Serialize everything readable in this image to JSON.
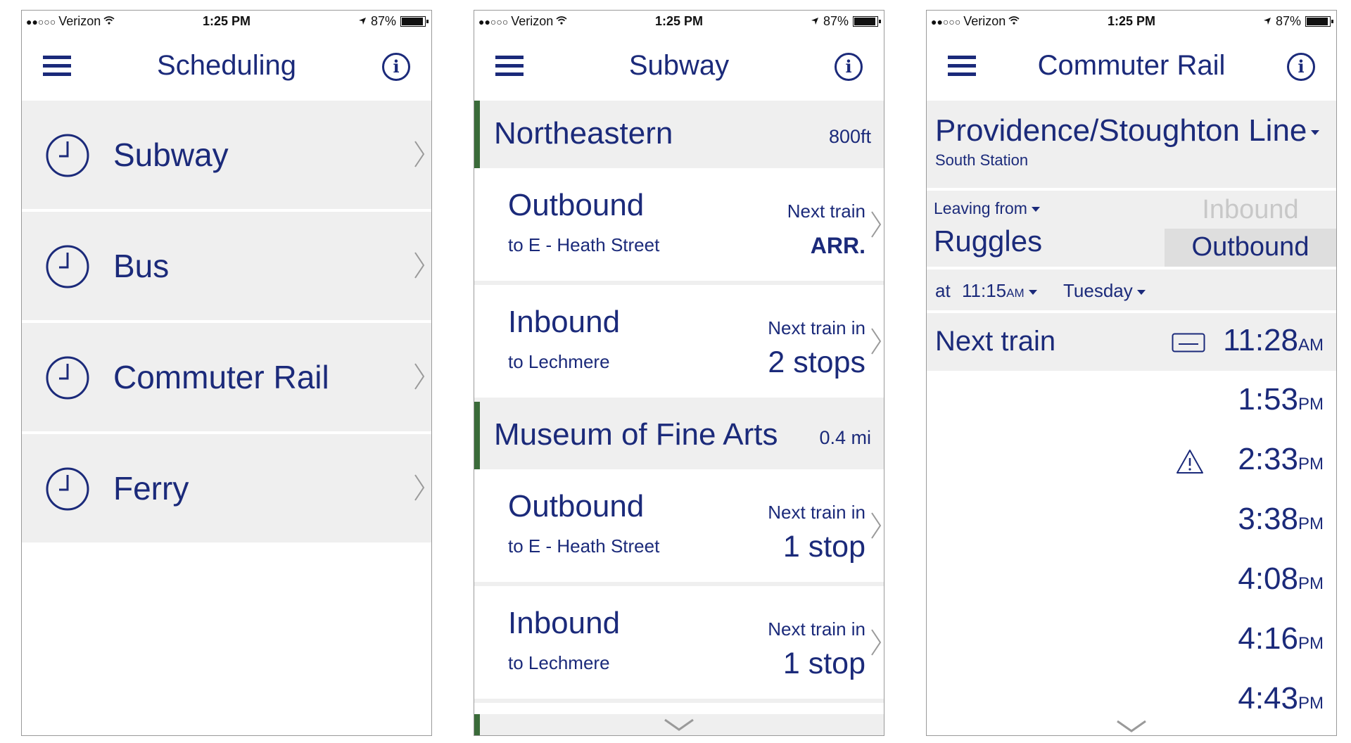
{
  "status_bar": {
    "signal_dots": "●●○○○",
    "carrier": "Verizon",
    "time": "1:25 PM",
    "battery": "87%",
    "battery_level": 0.87
  },
  "panel1": {
    "title": "Scheduling",
    "items": [
      {
        "label": "Subway"
      },
      {
        "label": "Bus"
      },
      {
        "label": "Commuter Rail"
      },
      {
        "label": "Ferry"
      }
    ]
  },
  "panel2": {
    "title": "Subway",
    "stations": [
      {
        "name": "Northeastern",
        "distance": "800ft",
        "directions": [
          {
            "direction": "Outbound",
            "destination": "to E - Heath Street",
            "next_label": "Next train",
            "next_value": "ARR."
          },
          {
            "direction": "Inbound",
            "destination": "to Lechmere",
            "next_label": "Next train in",
            "next_value": "2 stops"
          }
        ]
      },
      {
        "name": "Museum of Fine Arts",
        "distance": "0.4 mi",
        "directions": [
          {
            "direction": "Outbound",
            "destination": "to E - Heath Street",
            "next_label": "Next train in",
            "next_value": "1 stop"
          },
          {
            "direction": "Inbound",
            "destination": "to Lechmere",
            "next_label": "Next train in",
            "next_value": "1 stop"
          }
        ]
      }
    ]
  },
  "panel3": {
    "title": "Commuter Rail",
    "line_name": "Providence/Stoughton Line",
    "line_origin": "South Station",
    "leaving_label": "Leaving from",
    "leaving_station": "Ruggles",
    "direction_inactive": "Inbound",
    "direction_active": "Outbound",
    "at_label": "at",
    "time_value": "11:15",
    "time_ampm": "AM",
    "day_value": "Tuesday",
    "next_label": "Next train",
    "next_time": "11:28",
    "next_ampm": "AM",
    "times": [
      {
        "time": "1:53",
        "ampm": "PM"
      },
      {
        "time": "2:33",
        "ampm": "PM"
      },
      {
        "time": "3:38",
        "ampm": "PM"
      },
      {
        "time": "4:08",
        "ampm": "PM"
      },
      {
        "time": "4:16",
        "ampm": "PM"
      },
      {
        "time": "4:43",
        "ampm": "PM"
      }
    ]
  },
  "colors": {
    "primary": "#1b2a7a",
    "row_background": "#efefef",
    "station_accent": "#3a6b39"
  }
}
